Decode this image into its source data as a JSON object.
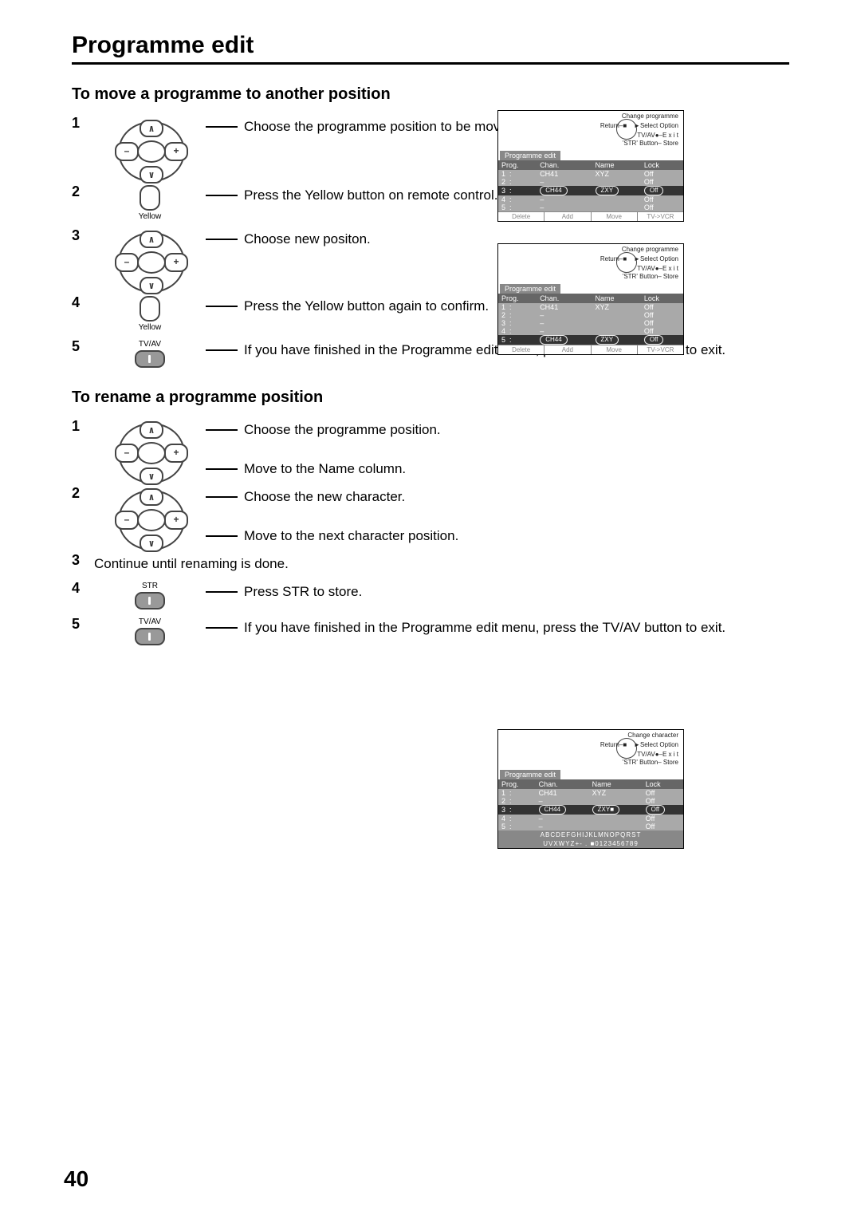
{
  "page_number": "40",
  "title": "Programme edit",
  "section_move": {
    "heading": "To move a programme to another position",
    "steps": [
      "Choose the programme position to be moved.",
      "Press the Yellow button on remote control.",
      "Choose new positon.",
      "Press the Yellow button again to confirm.",
      "If you have finished in the Programme edit menu, press the TV/AV button to exit."
    ],
    "labels": {
      "yellow": "Yellow",
      "tvav": "TV/AV"
    }
  },
  "section_rename": {
    "heading": "To rename a programme position",
    "steps": {
      "s1a": "Choose the programme position.",
      "s1b": "Move to the Name column.",
      "s2a": "Choose the new character.",
      "s2b": "Move to the next character position.",
      "s3": "Continue until renaming is done.",
      "s4": "Press STR to store.",
      "s5": "If you have finished in the Programme edit menu, press the TV/AV button to exit."
    },
    "labels": {
      "str": "STR",
      "tvav": "TV/AV"
    }
  },
  "osd_common": {
    "tab": "Programme edit",
    "headers": [
      "Prog.",
      "Chan.",
      "Name",
      "Lock"
    ],
    "hints": {
      "change_prog": "Change programme",
      "change_char": "Change character",
      "select_option": "Select Option",
      "return": "Return",
      "tvav_exit": "TV/AV●–E x i t",
      "str_store": "'STR' Button– Store"
    },
    "footer": [
      "Delete",
      "Add",
      "Move",
      "TV->VCR"
    ]
  },
  "osd1": {
    "rows": [
      {
        "prog": "1",
        "chan": "CH41",
        "name": "XYZ",
        "lock": "Off"
      },
      {
        "prog": "2",
        "chan": "–",
        "name": "",
        "lock": "Off"
      },
      {
        "prog": "3",
        "chan": "CH44",
        "name": "ZXY",
        "lock": "Off",
        "hl": true,
        "pill": true
      },
      {
        "prog": "4",
        "chan": "–",
        "name": "",
        "lock": "Off"
      },
      {
        "prog": "5",
        "chan": "–",
        "name": "",
        "lock": "Off"
      }
    ]
  },
  "osd2": {
    "rows": [
      {
        "prog": "1",
        "chan": "CH41",
        "name": "XYZ",
        "lock": "Off"
      },
      {
        "prog": "2",
        "chan": "–",
        "name": "",
        "lock": "Off"
      },
      {
        "prog": "3",
        "chan": "–",
        "name": "",
        "lock": "Off"
      },
      {
        "prog": "4",
        "chan": "–",
        "name": "",
        "lock": "Off"
      },
      {
        "prog": "5",
        "chan": "CH44",
        "name": "ZXY",
        "lock": "Off",
        "hl": true,
        "pill": true
      }
    ]
  },
  "osd3": {
    "rows": [
      {
        "prog": "1",
        "chan": "CH41",
        "name": "XYZ",
        "lock": "Off"
      },
      {
        "prog": "2",
        "chan": "–",
        "name": "",
        "lock": "Off"
      },
      {
        "prog": "3",
        "chan": "CH44",
        "name": "ZXY■",
        "lock": "Off",
        "hl": true,
        "pill": true
      },
      {
        "prog": "4",
        "chan": "–",
        "name": "",
        "lock": "Off"
      },
      {
        "prog": "5",
        "chan": "–",
        "name": "",
        "lock": "Off"
      }
    ],
    "chars_row1": "ABCDEFGHIJKLMNOPQRST",
    "chars_row2": "UVXWYZ+- . ■0123456789"
  }
}
